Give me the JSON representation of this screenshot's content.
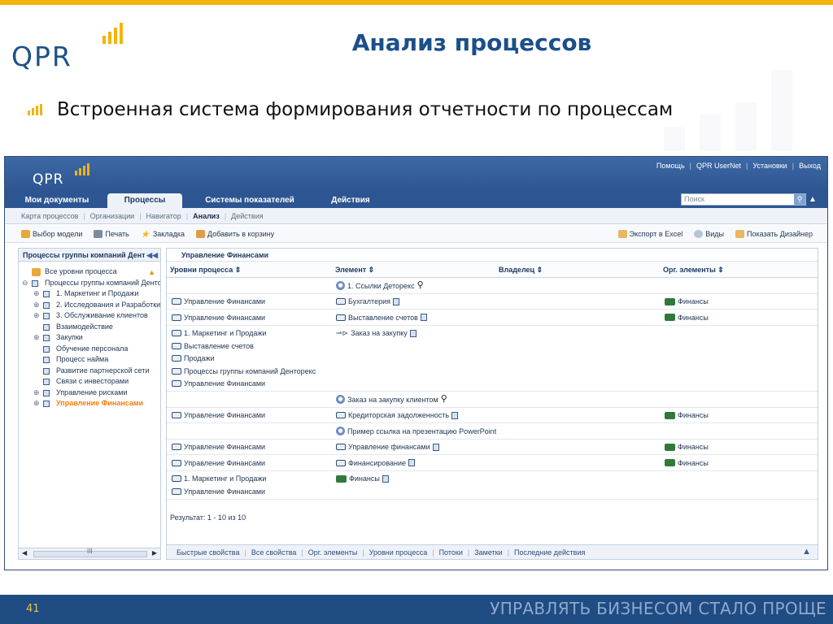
{
  "slide": {
    "logo_text": "QPR",
    "title": "Анализ процессов",
    "bullet": "Встроенная система формирования отчетности по процессам",
    "page_number": "41",
    "footer_slogan": "УПРАВЛЯТЬ БИЗНЕСОМ СТАЛО ПРОЩЕ",
    "accent_color": "#f3b30f",
    "brand_color": "#1d5289"
  },
  "app": {
    "logo_text": "QPR",
    "top_links": [
      "Помощь",
      "QPR UserNet",
      "Установки",
      "Выход"
    ],
    "tabs": [
      {
        "label": "Мои документы",
        "active": false
      },
      {
        "label": "Процессы",
        "active": true
      },
      {
        "label": "Системы показателей",
        "active": false
      },
      {
        "label": "Действия",
        "active": false
      }
    ],
    "search_placeholder": "Поиск",
    "subnav": [
      {
        "label": "Карта процессов",
        "active": false
      },
      {
        "label": "Организации",
        "active": false
      },
      {
        "label": "Навигатор",
        "active": false
      },
      {
        "label": "Анализ",
        "active": true
      },
      {
        "label": "Действия",
        "active": false
      }
    ],
    "toolbar_left": [
      {
        "label": "Выбор модели",
        "icon": "folder-icon"
      },
      {
        "label": "Печать",
        "icon": "print-icon"
      },
      {
        "label": "Закладка",
        "icon": "star-icon"
      },
      {
        "label": "Добавить в корзину",
        "icon": "cart-icon"
      }
    ],
    "toolbar_right": [
      {
        "label": "Экспорт в Excel",
        "icon": "excel-icon"
      },
      {
        "label": "Виды",
        "icon": "eye-icon"
      },
      {
        "label": "Показать Дизайнер",
        "icon": "designer-icon"
      }
    ],
    "left_panel": {
      "title": "Процессы группы компаний Денторекс",
      "scroll_thumb_label": "III",
      "tree": [
        {
          "label": "Все уровни процесса",
          "level": 0,
          "expander": "",
          "icon": "folder"
        },
        {
          "label": "Процессы группы компаний Денторекс",
          "level": 0,
          "expander": "⊖",
          "icon": "process"
        },
        {
          "label": "1. Маркетинг и Продажи",
          "level": 1,
          "expander": "⊕",
          "icon": "process"
        },
        {
          "label": "2. Исследования и Разработки",
          "level": 1,
          "expander": "⊕",
          "icon": "process"
        },
        {
          "label": "3. Обслуживание клиентов",
          "level": 1,
          "expander": "⊕",
          "icon": "process"
        },
        {
          "label": "Взаимодействие",
          "level": 1,
          "expander": "",
          "icon": "process"
        },
        {
          "label": "Закупки",
          "level": 1,
          "expander": "⊕",
          "icon": "process"
        },
        {
          "label": "Обучение персонала",
          "level": 1,
          "expander": "",
          "icon": "process"
        },
        {
          "label": "Процесс найма",
          "level": 1,
          "expander": "",
          "icon": "process"
        },
        {
          "label": "Развитие партнерской сети",
          "level": 1,
          "expander": "",
          "icon": "process"
        },
        {
          "label": "Связи с инвесторами",
          "level": 1,
          "expander": "",
          "icon": "process"
        },
        {
          "label": "Управление рисками",
          "level": 1,
          "expander": "⊕",
          "icon": "process"
        },
        {
          "label": "Управление Финансами",
          "level": 1,
          "expander": "⊕",
          "icon": "process",
          "highlight": true
        }
      ]
    },
    "main_panel": {
      "title": "Управление Финансами",
      "columns": [
        "Уровни процесса",
        "Элемент",
        "Владелец",
        "Орг. элементы"
      ],
      "rows": [
        {
          "levels": [],
          "element": {
            "label": "1. Ссылки Деторекс",
            "icon": "globe",
            "extra": "mag"
          },
          "owner": "",
          "org": ""
        },
        {
          "levels": [
            "Управление Финансами"
          ],
          "element": {
            "label": "Бухгалтерия",
            "icon": "monitor",
            "extra": "tree"
          },
          "owner": "",
          "org": "Финансы"
        },
        {
          "levels": [
            "Управление Финансами"
          ],
          "element": {
            "label": "Выставление счетов",
            "icon": "monitor",
            "extra": "tree"
          },
          "owner": "",
          "org": "Финансы"
        },
        {
          "levels": [
            "1. Маркетинг и Продажи",
            "Выставление счетов",
            "Продажи",
            "Процессы группы компаний Денторекс",
            "Управление Финансами"
          ],
          "element": {
            "label": "Заказ на закупку",
            "icon": "arrow",
            "extra": "tree"
          },
          "owner": "",
          "org": ""
        },
        {
          "levels": [],
          "element": {
            "label": "Заказ на закупку клиентом",
            "icon": "globe",
            "extra": "mag"
          },
          "owner": "",
          "org": ""
        },
        {
          "levels": [
            "Управление Финансами"
          ],
          "element": {
            "label": "Кредиторская задолженность",
            "icon": "monitor",
            "extra": "tree"
          },
          "owner": "",
          "org": "Финансы"
        },
        {
          "levels": [],
          "element": {
            "label": "Пример ссылка на презентацию PowerPoint",
            "icon": "globe",
            "extra": ""
          },
          "owner": "",
          "org": ""
        },
        {
          "levels": [
            "Управление Финансами"
          ],
          "element": {
            "label": "Управление финансами",
            "icon": "monitor",
            "extra": "tree"
          },
          "owner": "",
          "org": "Финансы"
        },
        {
          "levels": [
            "Управление Финансами"
          ],
          "element": {
            "label": "Финансирование",
            "icon": "monitor",
            "extra": "tree"
          },
          "owner": "",
          "org": "Финансы"
        },
        {
          "levels": [
            "1. Маркетинг и Продажи",
            "Управление Финансами"
          ],
          "element": {
            "label": "Финансы",
            "icon": "org",
            "extra": "tree"
          },
          "owner": "",
          "org": ""
        }
      ],
      "result_text": "Результат: 1 - 10 из 10",
      "bottom_tabs": [
        "Быстрые свойства",
        "Все свойства",
        "Орг. элементы",
        "Уровни процесса",
        "Потоки",
        "Заметки",
        "Последние действия"
      ]
    }
  }
}
